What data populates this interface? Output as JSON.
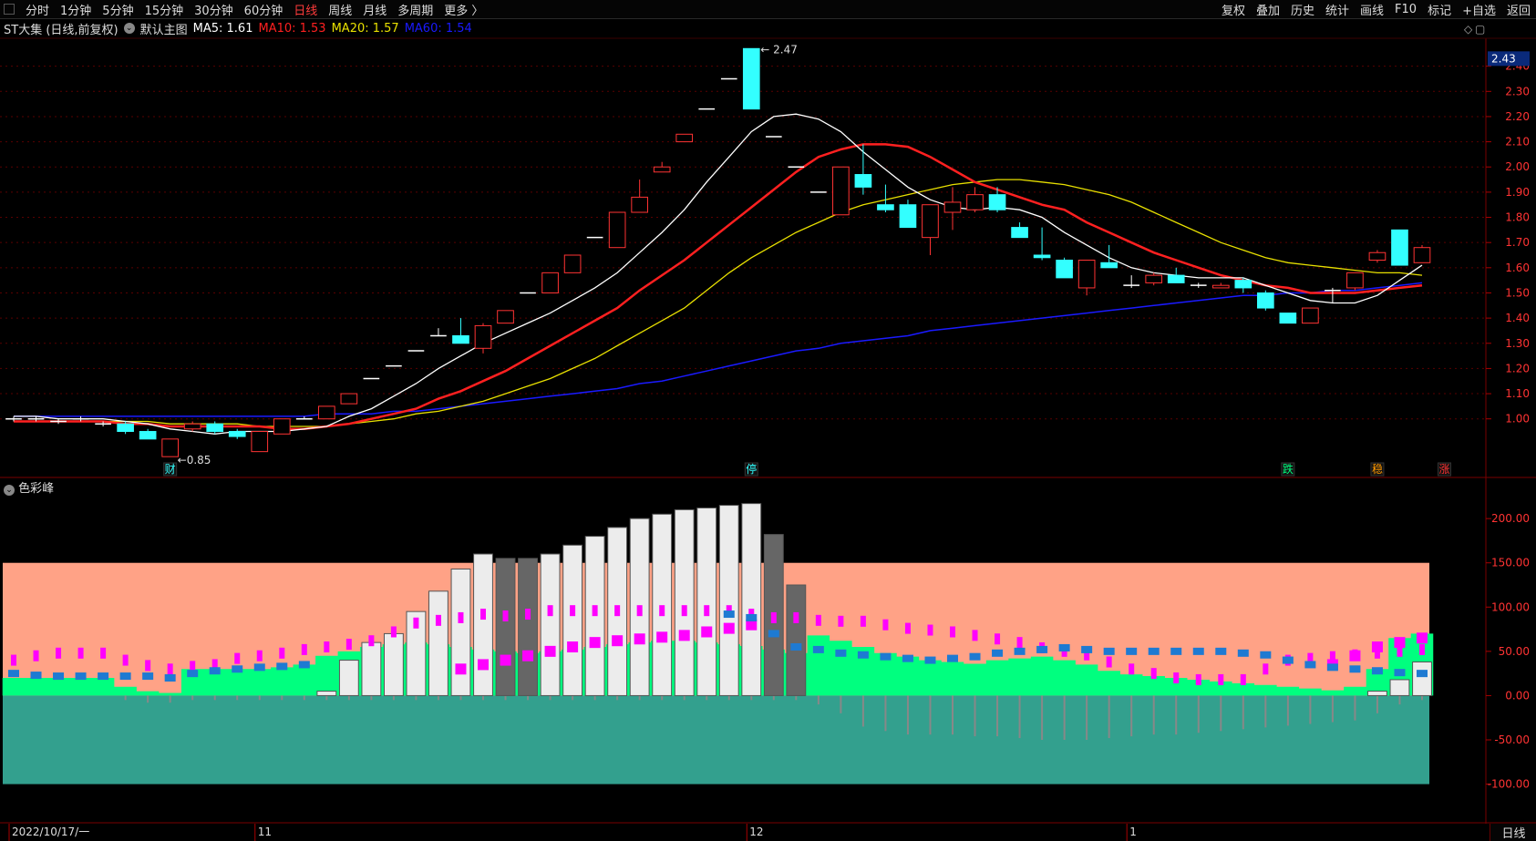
{
  "toolbar": {
    "periods": [
      "分时",
      "1分钟",
      "5分钟",
      "15分钟",
      "30分钟",
      "60分钟",
      "日线",
      "周线",
      "月线",
      "多周期",
      "更多 〉"
    ],
    "active_period": "日线",
    "right_buttons": [
      "复权",
      "叠加",
      "历史",
      "统计",
      "画线",
      "F10",
      "标记",
      "+自选",
      "返回"
    ]
  },
  "info": {
    "stock": "ST大集 (日线,前复权)",
    "main_chart": "默认主图",
    "ma5": "MA5: 1.61",
    "ma10": "MA10: 1.53",
    "ma20": "MA20: 1.57",
    "ma60": "MA60: 1.54"
  },
  "indicator_name": "色彩峰",
  "timeframe_label": "日线",
  "colors": {
    "up": "#ff3333",
    "down": "#33ffff",
    "ma5": "#ffffff",
    "ma10": "#ff2020",
    "ma20": "#e8e000",
    "ma60": "#1a1aff",
    "salmon": "#ffa286",
    "teal": "#33a08e",
    "green": "#00ff7f",
    "magenta": "#ff00ff",
    "blue_marker": "#1e7ad2"
  },
  "chart_data": [
    {
      "type": "candlestick",
      "ylim": [
        0.8,
        2.5
      ],
      "price_ticks": [
        "2.40",
        "2.30",
        "2.20",
        "2.10",
        "2.00",
        "1.90",
        "1.80",
        "1.70",
        "1.60",
        "1.50",
        "1.40",
        "1.30",
        "1.20",
        "1.10",
        "1.00"
      ],
      "last_price_label": "2.43",
      "high_label": "2.47",
      "low_label": "0.85",
      "ohlc": [
        [
          1.0,
          1.01,
          0.99,
          1.0
        ],
        [
          1.0,
          1.01,
          0.99,
          1.0
        ],
        [
          0.99,
          1.0,
          0.98,
          0.99
        ],
        [
          1.0,
          1.01,
          0.99,
          1.0
        ],
        [
          0.98,
          0.99,
          0.97,
          0.98
        ],
        [
          0.98,
          0.99,
          0.94,
          0.95
        ],
        [
          0.95,
          0.96,
          0.92,
          0.92
        ],
        [
          0.85,
          0.92,
          0.85,
          0.92
        ],
        [
          0.96,
          0.99,
          0.95,
          0.98
        ],
        [
          0.98,
          0.99,
          0.94,
          0.95
        ],
        [
          0.95,
          0.96,
          0.92,
          0.93
        ],
        [
          0.87,
          0.95,
          0.87,
          0.95
        ],
        [
          0.94,
          1.0,
          0.94,
          1.0
        ],
        [
          1.0,
          1.01,
          1.0,
          1.0
        ],
        [
          1.0,
          1.05,
          1.0,
          1.05
        ],
        [
          1.06,
          1.1,
          1.06,
          1.1
        ],
        [
          1.16,
          1.16,
          1.16,
          1.16
        ],
        [
          1.21,
          1.21,
          1.21,
          1.21
        ],
        [
          1.27,
          1.27,
          1.27,
          1.27
        ],
        [
          1.33,
          1.36,
          1.33,
          1.33
        ],
        [
          1.33,
          1.4,
          1.3,
          1.3
        ],
        [
          1.28,
          1.38,
          1.26,
          1.37
        ],
        [
          1.38,
          1.43,
          1.38,
          1.43
        ],
        [
          1.5,
          1.5,
          1.5,
          1.5
        ],
        [
          1.5,
          1.58,
          1.5,
          1.58
        ],
        [
          1.58,
          1.65,
          1.58,
          1.65
        ],
        [
          1.72,
          1.72,
          1.72,
          1.72
        ],
        [
          1.68,
          1.82,
          1.68,
          1.82
        ],
        [
          1.82,
          1.95,
          1.82,
          1.88
        ],
        [
          1.98,
          2.02,
          1.98,
          2.0
        ],
        [
          2.1,
          2.13,
          2.1,
          2.13
        ],
        [
          2.23,
          2.23,
          2.23,
          2.23
        ],
        [
          2.35,
          2.35,
          2.35,
          2.35
        ],
        [
          2.47,
          2.47,
          2.23,
          2.23
        ],
        [
          2.12,
          2.12,
          2.12,
          2.12
        ],
        [
          2.0,
          2.0,
          2.0,
          2.0
        ],
        [
          1.9,
          1.9,
          1.9,
          1.9
        ],
        [
          1.81,
          2.0,
          1.81,
          2.0
        ],
        [
          1.97,
          2.09,
          1.89,
          1.92
        ],
        [
          1.85,
          1.93,
          1.82,
          1.83
        ],
        [
          1.85,
          1.87,
          1.76,
          1.76
        ],
        [
          1.72,
          1.85,
          1.65,
          1.85
        ],
        [
          1.82,
          1.92,
          1.75,
          1.86
        ],
        [
          1.83,
          1.92,
          1.82,
          1.89
        ],
        [
          1.89,
          1.92,
          1.82,
          1.83
        ],
        [
          1.76,
          1.78,
          1.72,
          1.72
        ],
        [
          1.65,
          1.76,
          1.63,
          1.64
        ],
        [
          1.63,
          1.64,
          1.56,
          1.56
        ],
        [
          1.52,
          1.63,
          1.49,
          1.63
        ],
        [
          1.62,
          1.69,
          1.6,
          1.6
        ],
        [
          1.53,
          1.57,
          1.52,
          1.53
        ],
        [
          1.54,
          1.58,
          1.53,
          1.57
        ],
        [
          1.57,
          1.6,
          1.54,
          1.54
        ],
        [
          1.53,
          1.54,
          1.52,
          1.53
        ],
        [
          1.52,
          1.54,
          1.52,
          1.53
        ],
        [
          1.55,
          1.56,
          1.5,
          1.52
        ],
        [
          1.5,
          1.51,
          1.43,
          1.44
        ],
        [
          1.42,
          1.42,
          1.38,
          1.38
        ],
        [
          1.38,
          1.44,
          1.38,
          1.44
        ],
        [
          1.51,
          1.52,
          1.46,
          1.51
        ],
        [
          1.52,
          1.58,
          1.51,
          1.58
        ],
        [
          1.63,
          1.67,
          1.62,
          1.66
        ],
        [
          1.75,
          1.75,
          1.61,
          1.61
        ],
        [
          1.62,
          1.69,
          1.62,
          1.68
        ]
      ],
      "ma5": [
        1.01,
        1.01,
        1.0,
        1.0,
        1.0,
        0.99,
        0.98,
        0.96,
        0.95,
        0.94,
        0.95,
        0.95,
        0.95,
        0.96,
        0.97,
        1.01,
        1.04,
        1.09,
        1.14,
        1.2,
        1.25,
        1.3,
        1.34,
        1.38,
        1.42,
        1.47,
        1.52,
        1.58,
        1.66,
        1.74,
        1.83,
        1.94,
        2.04,
        2.14,
        2.2,
        2.21,
        2.19,
        2.14,
        2.06,
        1.99,
        1.92,
        1.87,
        1.84,
        1.83,
        1.84,
        1.83,
        1.8,
        1.74,
        1.69,
        1.64,
        1.6,
        1.58,
        1.57,
        1.56,
        1.56,
        1.56,
        1.53,
        1.5,
        1.47,
        1.46,
        1.46,
        1.49,
        1.55,
        1.61
      ],
      "ma10": [
        0.99,
        0.99,
        0.99,
        0.99,
        0.99,
        0.98,
        0.98,
        0.97,
        0.97,
        0.97,
        0.97,
        0.97,
        0.96,
        0.96,
        0.97,
        0.98,
        1.0,
        1.02,
        1.04,
        1.08,
        1.11,
        1.15,
        1.19,
        1.24,
        1.29,
        1.34,
        1.39,
        1.44,
        1.51,
        1.57,
        1.63,
        1.7,
        1.77,
        1.84,
        1.91,
        1.98,
        2.04,
        2.07,
        2.09,
        2.09,
        2.08,
        2.04,
        1.99,
        1.94,
        1.91,
        1.88,
        1.85,
        1.83,
        1.78,
        1.74,
        1.7,
        1.66,
        1.63,
        1.6,
        1.57,
        1.55,
        1.53,
        1.52,
        1.5,
        1.5,
        1.5,
        1.51,
        1.52,
        1.53
      ],
      "ma20": [
        0.99,
        0.99,
        0.99,
        0.99,
        0.99,
        0.99,
        0.99,
        0.98,
        0.98,
        0.98,
        0.98,
        0.97,
        0.97,
        0.97,
        0.97,
        0.98,
        0.99,
        1.0,
        1.02,
        1.03,
        1.05,
        1.07,
        1.1,
        1.13,
        1.16,
        1.2,
        1.24,
        1.29,
        1.34,
        1.39,
        1.44,
        1.51,
        1.58,
        1.64,
        1.69,
        1.74,
        1.78,
        1.82,
        1.85,
        1.87,
        1.89,
        1.91,
        1.93,
        1.94,
        1.95,
        1.95,
        1.94,
        1.93,
        1.91,
        1.89,
        1.86,
        1.82,
        1.78,
        1.74,
        1.7,
        1.67,
        1.64,
        1.62,
        1.61,
        1.6,
        1.59,
        1.58,
        1.58,
        1.57
      ],
      "ma60": [
        1.01,
        1.01,
        1.01,
        1.01,
        1.01,
        1.01,
        1.01,
        1.01,
        1.01,
        1.01,
        1.01,
        1.01,
        1.01,
        1.01,
        1.02,
        1.02,
        1.02,
        1.03,
        1.03,
        1.04,
        1.05,
        1.06,
        1.07,
        1.08,
        1.09,
        1.1,
        1.11,
        1.12,
        1.14,
        1.15,
        1.17,
        1.19,
        1.21,
        1.23,
        1.25,
        1.27,
        1.28,
        1.3,
        1.31,
        1.32,
        1.33,
        1.35,
        1.36,
        1.37,
        1.38,
        1.39,
        1.4,
        1.41,
        1.42,
        1.43,
        1.44,
        1.45,
        1.46,
        1.47,
        1.48,
        1.49,
        1.49,
        1.5,
        1.5,
        1.51,
        1.51,
        1.52,
        1.53,
        1.54
      ],
      "event_markers": [
        {
          "label": "财",
          "index": 7,
          "color": "#33ffff"
        },
        {
          "label": "停",
          "index": 33,
          "color": "#33ffff"
        },
        {
          "label": "跌",
          "index": 57,
          "color": "#00ff7f"
        },
        {
          "label": "稳",
          "index": 61,
          "color": "#ff9900"
        },
        {
          "label": "涨",
          "index": 64,
          "color": "#ff3333"
        }
      ],
      "x_labels": [
        {
          "label": "2022/10/17/一",
          "index": 0
        },
        {
          "label": "11",
          "index": 11
        },
        {
          "label": "12",
          "index": 33
        },
        {
          "label": "1",
          "index": 50
        }
      ]
    },
    {
      "type": "bar",
      "title": "色彩峰",
      "ylim": [
        -120,
        230
      ],
      "ticks": [
        "200.00",
        "150.00",
        "100.00",
        "50.00",
        "0.00",
        "-50.00",
        "-100.00"
      ],
      "salmon_band_top": 150,
      "teal_band_bottom": -100,
      "main_bars": [
        0,
        0,
        0,
        0,
        0,
        0,
        0,
        0,
        0,
        0,
        0,
        0,
        0,
        0,
        5,
        40,
        60,
        70,
        95,
        118,
        143,
        160,
        155,
        155,
        160,
        170,
        180,
        190,
        200,
        205,
        210,
        212,
        215,
        217,
        182,
        125,
        0,
        0,
        0,
        0,
        0,
        0,
        0,
        0,
        0,
        0,
        0,
        0,
        0,
        0,
        0,
        0,
        0,
        0,
        0,
        0,
        0,
        0,
        0,
        0,
        0,
        5,
        18,
        38
      ],
      "main_bar_colors": [
        "w",
        "w",
        "w",
        "w",
        "w",
        "w",
        "w",
        "w",
        "w",
        "w",
        "w",
        "w",
        "w",
        "w",
        "w",
        "w",
        "w",
        "w",
        "w",
        "w",
        "w",
        "w",
        "g",
        "g",
        "w",
        "w",
        "w",
        "w",
        "w",
        "w",
        "w",
        "w",
        "w",
        "w",
        "g",
        "g",
        "w",
        "w",
        "w",
        "w",
        "w",
        "w",
        "w",
        "w",
        "w",
        "w",
        "w",
        "w",
        "w",
        "w",
        "w",
        "w",
        "w",
        "w",
        "w",
        "w",
        "w",
        "w",
        "w",
        "w",
        "w",
        "w",
        "w",
        "w"
      ],
      "green_area": [
        20,
        20,
        20,
        20,
        20,
        10,
        5,
        3,
        30,
        30,
        30,
        30,
        32,
        35,
        45,
        50,
        55,
        58,
        60,
        58,
        55,
        52,
        50,
        48,
        50,
        52,
        55,
        58,
        60,
        62,
        62,
        60,
        58,
        56,
        52,
        48,
        68,
        62,
        55,
        48,
        44,
        40,
        38,
        36,
        40,
        42,
        44,
        40,
        35,
        28,
        24,
        22,
        20,
        18,
        16,
        14,
        12,
        10,
        8,
        6,
        10,
        30,
        65,
        70
      ],
      "magenta_markers": [
        40,
        45,
        48,
        48,
        48,
        40,
        34,
        30,
        33,
        35,
        42,
        45,
        48,
        52,
        55,
        58,
        62,
        72,
        82,
        85,
        88,
        92,
        90,
        92,
        96,
        96,
        96,
        96,
        96,
        96,
        96,
        96,
        96,
        92,
        88,
        88,
        85,
        84,
        84,
        80,
        76,
        74,
        72,
        68,
        64,
        60,
        54,
        50,
        46,
        38,
        30,
        25,
        20,
        18,
        18,
        18,
        30,
        40,
        42,
        44,
        46,
        48,
        50,
        52
      ],
      "magenta_lower": [
        0,
        0,
        0,
        0,
        0,
        0,
        0,
        0,
        0,
        0,
        0,
        0,
        0,
        0,
        0,
        0,
        0,
        0,
        0,
        0,
        30,
        35,
        40,
        45,
        50,
        55,
        60,
        62,
        64,
        66,
        68,
        72,
        76,
        80,
        0,
        0,
        0,
        0,
        0,
        0,
        0,
        0,
        0,
        0,
        0,
        0,
        0,
        0,
        0,
        0,
        0,
        0,
        0,
        0,
        0,
        0,
        0,
        0,
        0,
        35,
        45,
        55,
        60,
        65
      ],
      "blue_markers": [
        25,
        23,
        22,
        22,
        22,
        22,
        22,
        20,
        25,
        28,
        30,
        32,
        33,
        35,
        0,
        0,
        0,
        0,
        0,
        0,
        0,
        0,
        0,
        0,
        0,
        0,
        0,
        0,
        0,
        0,
        0,
        0,
        92,
        88,
        70,
        55,
        52,
        48,
        46,
        44,
        42,
        40,
        42,
        44,
        48,
        50,
        52,
        54,
        52,
        50,
        50,
        50,
        50,
        50,
        50,
        48,
        46,
        40,
        35,
        32,
        30,
        28,
        26,
        25
      ],
      "gray_stems": [
        0,
        0,
        0,
        0,
        0,
        -5,
        -8,
        -8,
        -5,
        -5,
        -5,
        -5,
        -5,
        -5,
        -5,
        -5,
        -5,
        -5,
        -5,
        -5,
        -5,
        -5,
        -5,
        -5,
        -5,
        -5,
        -5,
        -5,
        -5,
        -5,
        -5,
        -5,
        -5,
        -5,
        -5,
        -5,
        -10,
        -20,
        -35,
        -40,
        -44,
        -44,
        -44,
        -46,
        -46,
        -48,
        -50,
        -50,
        -50,
        -48,
        -46,
        -44,
        -44,
        -42,
        -40,
        -38,
        -36,
        -34,
        -32,
        -30,
        -28,
        -20,
        -10,
        -5
      ]
    }
  ]
}
